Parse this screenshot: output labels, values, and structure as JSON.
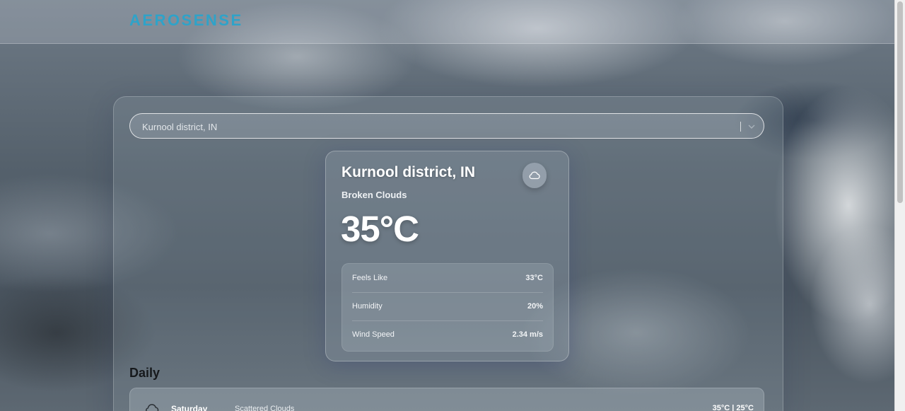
{
  "header": {
    "logo": "AEROSENSE",
    "accent_color": "#2ea3c9"
  },
  "search": {
    "value": "Kurnool district, IN",
    "icon": "chevron-down-icon"
  },
  "current": {
    "location": "Kurnool district, IN",
    "condition": "Broken Clouds",
    "temperature": "35°C",
    "icon": "cloud-icon",
    "details": [
      {
        "label": "Feels Like",
        "value": "33°C"
      },
      {
        "label": "Humidity",
        "value": "20%"
      },
      {
        "label": "Wind Speed",
        "value": "2.34 m/s"
      }
    ]
  },
  "daily": {
    "title": "Daily",
    "items": [
      {
        "day": "Saturday",
        "condition": "Scattered Clouds",
        "range": "35°C | 25°C",
        "icon": "cloud-icon"
      }
    ]
  }
}
